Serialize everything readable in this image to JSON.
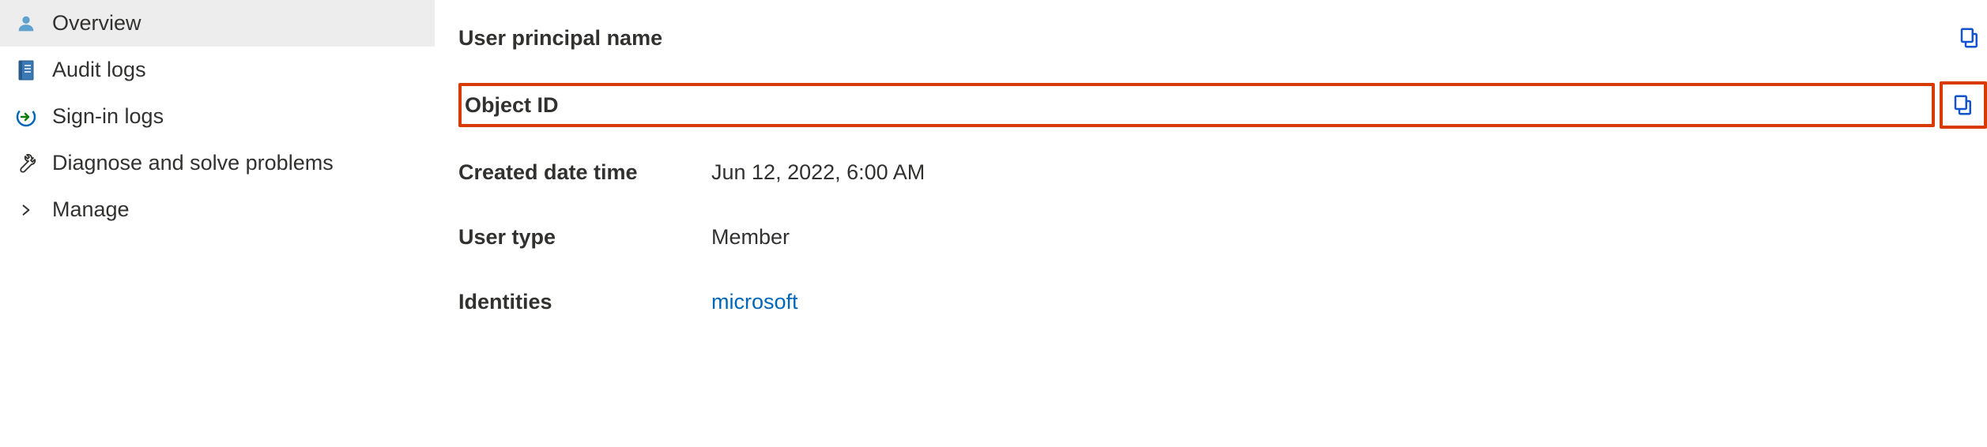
{
  "sidebar": {
    "items": [
      {
        "label": "Overview"
      },
      {
        "label": "Audit logs"
      },
      {
        "label": "Sign-in logs"
      },
      {
        "label": "Diagnose and solve problems"
      },
      {
        "label": "Manage"
      }
    ]
  },
  "details": {
    "user_principal_name": {
      "label": "User principal name",
      "value": ""
    },
    "object_id": {
      "label": "Object ID",
      "value": ""
    },
    "created_date_time": {
      "label": "Created date time",
      "value": "Jun 12, 2022, 6:00 AM"
    },
    "user_type": {
      "label": "User type",
      "value": "Member"
    },
    "identities": {
      "label": "Identities",
      "value": "microsoft"
    }
  }
}
